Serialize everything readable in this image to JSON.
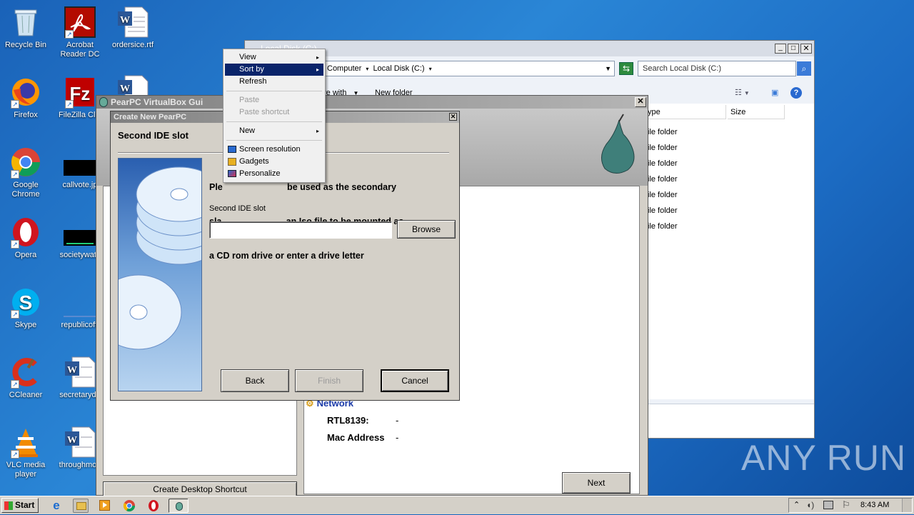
{
  "desktop": {
    "icons": [
      {
        "label": "Recycle Bin",
        "icon": "recycle-bin-icon"
      },
      {
        "label": "Acrobat Reader DC",
        "icon": "acrobat-icon"
      },
      {
        "label": "ordersice.rtf",
        "icon": "word-doc-icon"
      },
      {
        "label": "Firefox",
        "icon": "firefox-icon"
      },
      {
        "label": "FileZilla Clie",
        "icon": "filezilla-icon"
      },
      {
        "label": "Google Chrome",
        "icon": "chrome-icon"
      },
      {
        "label": "callvote.jp",
        "icon": "image-icon"
      },
      {
        "label": "Opera",
        "icon": "opera-icon"
      },
      {
        "label": "societywatc",
        "icon": "image-icon"
      },
      {
        "label": "Skype",
        "icon": "skype-icon"
      },
      {
        "label": "republicoffi",
        "icon": "image-icon"
      },
      {
        "label": "CCleaner",
        "icon": "ccleaner-icon"
      },
      {
        "label": "secretaryde",
        "icon": "word-doc-icon"
      },
      {
        "label": "VLC media player",
        "icon": "vlc-icon"
      },
      {
        "label": "throughmon",
        "icon": "word-doc-icon"
      }
    ],
    "watermark": "ANY RUN"
  },
  "explorer": {
    "title": "Local Disk (C:)",
    "breadcrumb": [
      "Computer",
      "Local Disk (C:)"
    ],
    "search_placeholder": "Search Local Disk (C:)",
    "toolbar": {
      "share_label": "re with",
      "new_folder": "New folder"
    },
    "columns": [
      "ype",
      "Size"
    ],
    "rows": [
      "ile folder",
      "ile folder",
      "ile folder",
      "ile folder",
      "ile folder",
      "ile folder",
      "ile folder"
    ]
  },
  "pearpc": {
    "title": "PearPC VirtualBox Gui",
    "network_label": "Network",
    "rtl_label": "RTL8139:",
    "rtl_value": "-",
    "mac_label": "Mac Address",
    "mac_value": "-",
    "next_label": "Next",
    "shortcut_label": "Create Desktop Shortcut"
  },
  "wizard": {
    "title": "Create New PearPC",
    "heading": "Second IDE slot",
    "desc_line1": "Ple                          be used as the secondary",
    "desc_line2": "sla                          an Iso file to be mounted as",
    "desc_line3": "a CD rom drive or enter a drive letter",
    "field_label": "Second IDE slot",
    "field_value": "",
    "browse_label": "Browse",
    "back_label": "Back",
    "finish_label": "Finish",
    "cancel_label": "Cancel"
  },
  "context_menu": {
    "items": [
      {
        "label": "View",
        "sub": "▸"
      },
      {
        "label": "Sort by",
        "sub": "▸"
      },
      {
        "label": "Refresh"
      },
      {
        "label": "Paste"
      },
      {
        "label": "Paste shortcut"
      },
      {
        "label": "New",
        "sub": "▸"
      },
      {
        "label": "Screen resolution"
      },
      {
        "label": "Gadgets"
      },
      {
        "label": "Personalize"
      }
    ]
  },
  "taskbar": {
    "start_label": "Start",
    "clock": "8:43 AM"
  }
}
